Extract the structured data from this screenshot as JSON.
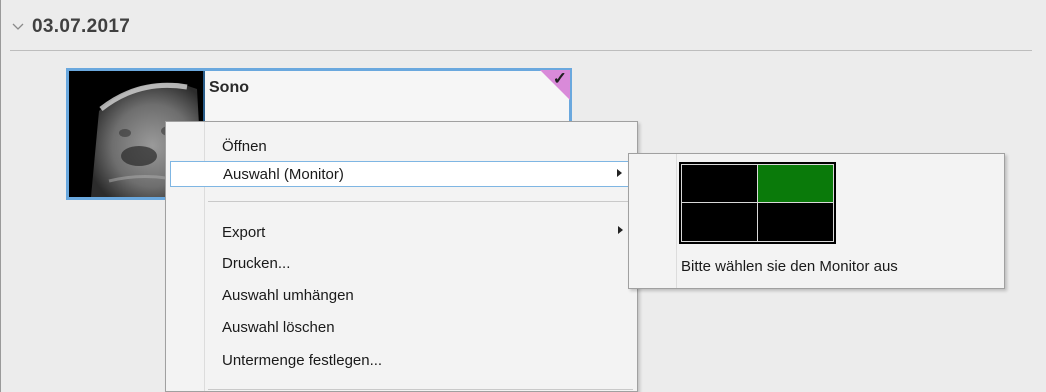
{
  "group": {
    "title": "03.07.2017",
    "expander_icon": "chevron-down-icon"
  },
  "card": {
    "title": "Sono",
    "selected_color": "#6aa8de",
    "flag_color": "#d98ad9",
    "flag_icon": "checkmark-icon"
  },
  "context_menu": {
    "items": [
      {
        "label": "Öffnen"
      },
      {
        "label": "Auswahl (Monitor)",
        "has_submenu": true,
        "highlighted": true
      },
      {
        "label": "Export",
        "has_submenu": true
      },
      {
        "label": "Drucken..."
      },
      {
        "label": "Auswahl umhängen"
      },
      {
        "label": "Auswahl löschen"
      },
      {
        "label": "Untermenge festlegen..."
      }
    ]
  },
  "monitor_submenu": {
    "label": "Bitte wählen sie den Monitor aus",
    "layout": "2x2",
    "selected_monitor": 2,
    "selected_color": "#0a7a0a"
  }
}
